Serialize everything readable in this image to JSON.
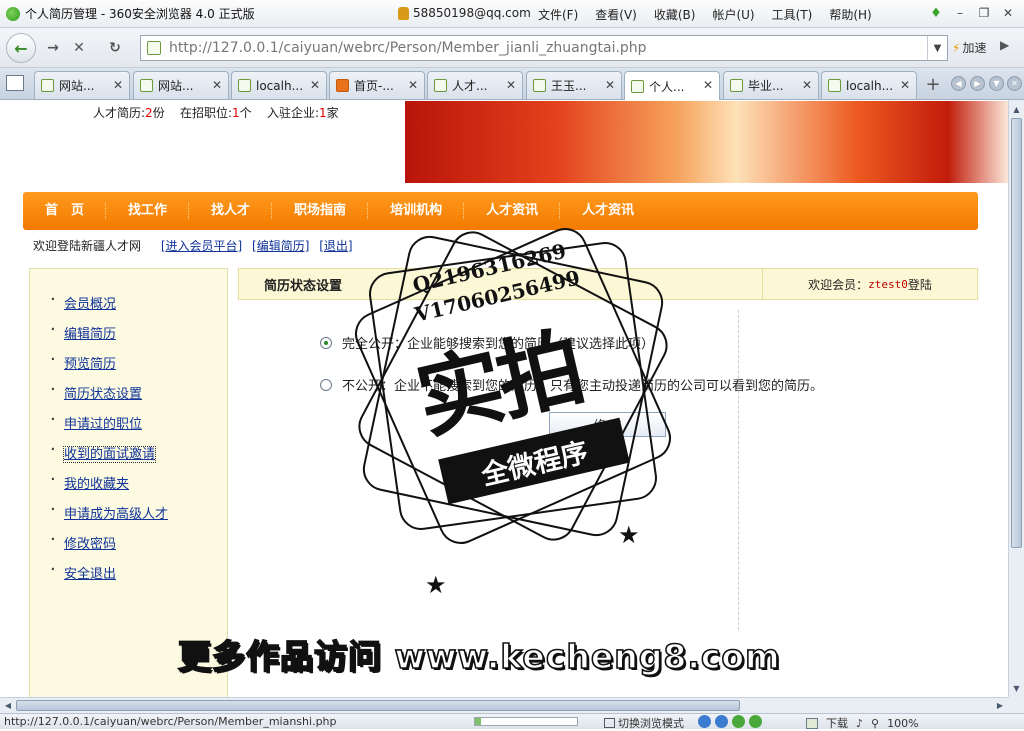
{
  "browser": {
    "window_title": "个人简历管理 - 360安全浏览器 4.0 正式版",
    "account": "58850198@qq.com",
    "menu": [
      "文件(F)",
      "查看(V)",
      "收藏(B)",
      "帐户(U)",
      "工具(T)",
      "帮助(H)"
    ],
    "url": "http://127.0.0.1/caiyuan/webrc/Person/Member_jianli_zhuangtai.php",
    "speed_label": "加速",
    "tabs": [
      {
        "label": "网站..."
      },
      {
        "label": "网站..."
      },
      {
        "label": "localh..."
      },
      {
        "label": "首页-..."
      },
      {
        "label": "人才..."
      },
      {
        "label": "王玉..."
      },
      {
        "label": "个人..."
      },
      {
        "label": "毕业..."
      },
      {
        "label": "localh..."
      }
    ],
    "active_tab": 6,
    "status_url": "http://127.0.0.1/caiyuan/webrc/Person/Member_mianshi.php",
    "status_mode": "切换浏览模式",
    "status_download": "下载",
    "status_zoom": "100%"
  },
  "site": {
    "stats": {
      "resume_label": "人才简历:",
      "resume_count": "2",
      "resume_unit": "份",
      "jobs_label": "在招职位:",
      "jobs_count": "1",
      "jobs_unit": "个",
      "companies_label": "入驻企业:",
      "companies_count": "1",
      "companies_unit": "家"
    },
    "nav": [
      "首　页",
      "找工作",
      "找人才",
      "职场指南",
      "培训机构",
      "人才资讯",
      "人才资讯"
    ],
    "welcome": {
      "text": "欢迎登陆新疆人才网",
      "links": [
        "[进入会员平台]",
        "[编辑简历]",
        "[退出]"
      ]
    },
    "sidebar": [
      "会员概况",
      "编辑简历",
      "预览简历",
      "简历状态设置",
      "申请过的职位",
      "收到的面试邀请",
      "我的收藏夹",
      "申请成为高级人才",
      "修改密码",
      "安全退出"
    ],
    "panel": {
      "title": "简历状态设置",
      "user_prefix": "欢迎会员：",
      "user_name": "ztest0",
      "user_suffix": "登陆",
      "option_public": "完全公开：企业能够搜索到您的简历（建议选择此项）",
      "option_private": "不公开：企业不能搜索到您的简历，只有您主动投递简历的公司可以看到您的简历。",
      "submit_label": "修 改"
    }
  },
  "watermark": {
    "contact_q": "Q2196316269",
    "contact_v": "V17060256499",
    "stamp_big": "实拍",
    "stamp_ribbon": "全微程序",
    "footer": "更多作品访问 www.kecheng8.com"
  }
}
